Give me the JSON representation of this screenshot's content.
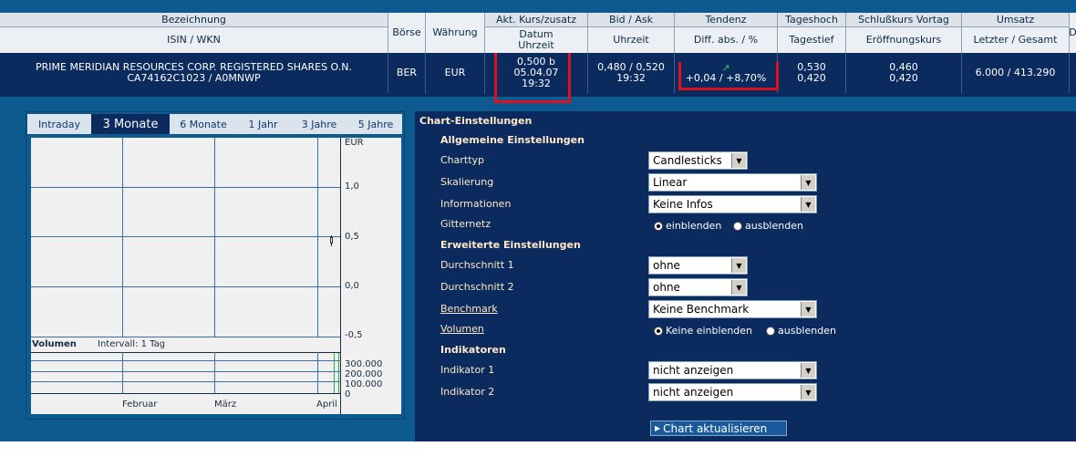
{
  "quote_table": {
    "headers": {
      "bezeichnung": "Bezeichnung",
      "isin_wkn": "ISIN / WKN",
      "boerse": "Börse",
      "waehrung": "Währung",
      "kurs": "Akt. Kurs/zusatz",
      "kurs_sub1": "Datum",
      "kurs_sub2": "Uhrzeit",
      "bid_ask": "Bid / Ask",
      "bid_ask_sub": "Uhrzeit",
      "tendenz": "Tendenz",
      "tendenz_sub": "Diff. abs. / %",
      "tageshoch": "Tageshoch",
      "tagestief": "Tagestief",
      "schluss": "Schlußkurs Vortag",
      "eroeffnung": "Eröffnungskurs",
      "umsatz": "Umsatz",
      "umsatz_sub": "Letzter / Gesamt",
      "cut": "D"
    },
    "row": {
      "name": "PRIME MERIDIAN RESOURCES CORP. REGISTERED SHARES O.N.",
      "isin_wkn": "CA74162C1023 / A0MNWP",
      "boerse": "BER",
      "waehrung": "EUR",
      "kurs": "0,500 b",
      "datum": "05.04.07",
      "uhrzeit": "19:32",
      "bid_ask": "0,480 / 0,520",
      "bid_ask_time": "19:32",
      "tendenz_arrow": "↗",
      "diff": "+0,04 / +8,70%",
      "hoch": "0,530",
      "tief": "0,420",
      "vortag": "0,460",
      "eroeffnung": "0,420",
      "umsatz": "6.000 / 413.290"
    }
  },
  "chart": {
    "tabs": [
      "Intraday",
      "3 Monate",
      "6 Monate",
      "1 Jahr",
      "3 Jahre",
      "5 Jahre"
    ],
    "active_tab": "3 Monate",
    "currency": "EUR",
    "y_ticks": [
      "1,0",
      "0,5",
      "0,0",
      "-0,5"
    ],
    "volume_title": "Volumen",
    "interval": "Intervall: 1 Tag",
    "vol_ticks": [
      "300.000",
      "200.000",
      "100.000",
      "0"
    ],
    "months": [
      "Februar",
      "März",
      "April"
    ]
  },
  "settings": {
    "title": "Chart-Einstellungen",
    "general_title": "Allgemeine Einstellungen",
    "charttyp_label": "Charttyp",
    "charttyp_value": "Candlesticks",
    "skalierung_label": "Skalierung",
    "skalierung_value": "Linear",
    "info_label": "Informationen",
    "info_value": "Keine Infos",
    "grid_label": "Gitternetz",
    "grid_on": "einblenden",
    "grid_off": "ausblenden",
    "advanced_title": "Erweiterte Einstellungen",
    "avg1_label": "Durchschnitt 1",
    "avg1_value": "ohne",
    "avg2_label": "Durchschnitt 2",
    "avg2_value": "ohne",
    "benchmark_label": "Benchmark",
    "benchmark_value": "Keine Benchmark",
    "volume_label": "Volumen",
    "volume_on": "Keine einblenden",
    "volume_off": "ausblenden",
    "indicators_title": "Indikatoren",
    "ind1_label": "Indikator 1",
    "ind1_value": "nicht anzeigen",
    "ind2_label": "Indikator 2",
    "ind2_value": "nicht anzeigen",
    "update_label": "Chart aktualisieren"
  },
  "colors": {
    "header_blue": "#0d5a91",
    "panel_navy": "#0b2a5e",
    "highlight_red": "#e01020",
    "label_cream": "#ffe9c8"
  }
}
